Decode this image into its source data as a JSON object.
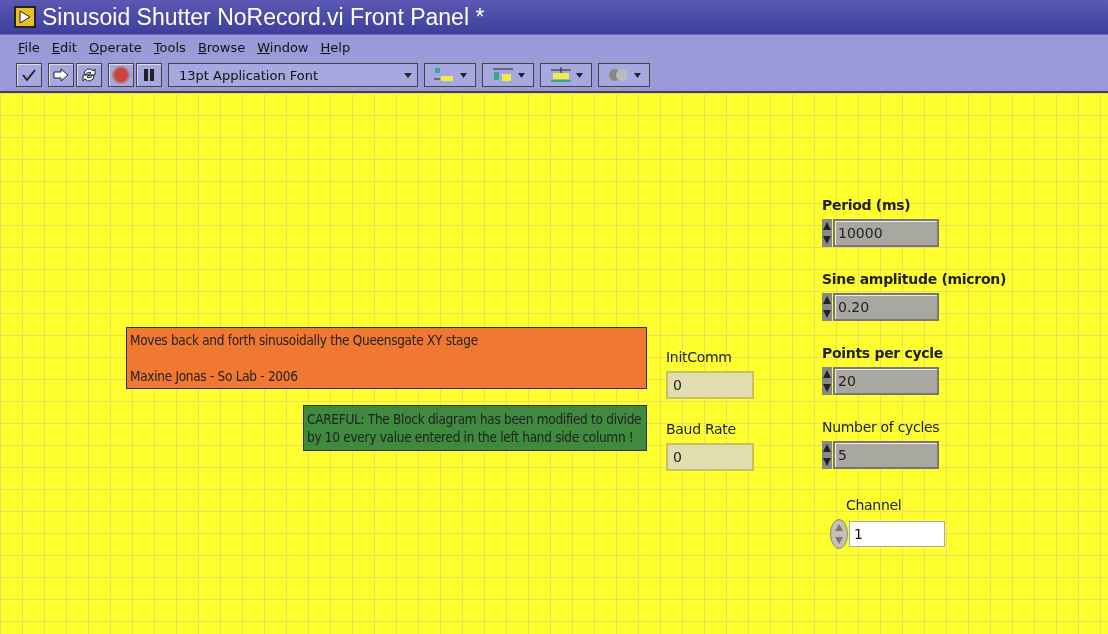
{
  "window": {
    "title": "Sinusoid Shutter NoRecord.vi Front Panel *"
  },
  "menu": [
    "File",
    "Edit",
    "Operate",
    "Tools",
    "Browse",
    "Window",
    "Help"
  ],
  "toolbar": {
    "font": "13pt Application Font"
  },
  "notes": [
    {
      "color": "#f07830",
      "lines": [
        "Moves back and forth sinusoidally the Queensgate XY stage",
        "Maxine Jonas - So Lab - 2006"
      ]
    },
    {
      "color": "#3f8a3f",
      "lines": [
        "CAREFUL: The Block diagram has been modified to divide by 10 every value entered in the left hand side column !"
      ]
    }
  ],
  "indicators": [
    {
      "label": "InitComm",
      "value": "0"
    },
    {
      "label": "Baud Rate",
      "value": "0"
    }
  ],
  "controls": [
    {
      "kind": "numeric",
      "label": "Period (ms)",
      "label_bold": true,
      "value": "10000"
    },
    {
      "kind": "numeric",
      "label": "Sine amplitude (micron)",
      "label_bold": true,
      "value": "0.20"
    },
    {
      "kind": "numeric",
      "label": "Points per cycle",
      "label_bold": true,
      "value": "20"
    },
    {
      "kind": "numeric",
      "label": "Number of cycles",
      "label_bold": false,
      "value": "5"
    },
    {
      "kind": "ring",
      "label": "Channel",
      "label_bold": false,
      "value": "1"
    }
  ]
}
